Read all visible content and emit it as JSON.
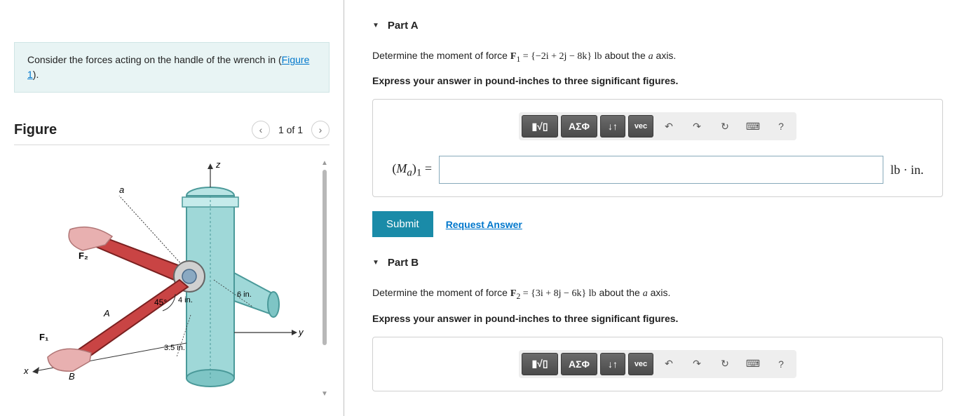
{
  "prompt": {
    "text_before": "Consider the forces acting on the handle of the wrench in (",
    "figure_link": "Figure 1",
    "text_after": ")."
  },
  "figure": {
    "title": "Figure",
    "nav_label": "1 of 1",
    "labels": {
      "z": "z",
      "y": "y",
      "x": "x",
      "a": "a",
      "A": "A",
      "B": "B",
      "F1": "F₁",
      "F2": "F₂",
      "ang": "45°",
      "d1": "4 in.",
      "d2": "6 in.",
      "d3": "3.5 in."
    }
  },
  "parts": {
    "A": {
      "title": "Part A",
      "q_before": "Determine the moment of force ",
      "q_force": "F",
      "q_sub": "1",
      "q_eq": " = {−2i + 2j − 8k} lb",
      "q_after": " about the ",
      "q_axis": "a",
      "q_end": " axis.",
      "instruction": "Express your answer in pound-inches to three significant figures.",
      "label_html": "(Mₐ)₁ =",
      "unit": "lb · in.",
      "submit": "Submit",
      "request": "Request Answer"
    },
    "B": {
      "title": "Part B",
      "q_before": "Determine the moment of force ",
      "q_force": "F",
      "q_sub": "2",
      "q_eq": " = {3i + 8j − 6k} lb",
      "q_after": " about the ",
      "q_axis": "a",
      "q_end": " axis.",
      "instruction": "Express your answer in pound-inches to three significant figures."
    }
  },
  "toolbar": {
    "templates": "▮√▯",
    "greek": "ΑΣΦ",
    "subscript": "↓↑",
    "vec": "vec",
    "undo": "↶",
    "redo": "↷",
    "reset": "↻",
    "keyboard": "⌨",
    "help": "?"
  }
}
